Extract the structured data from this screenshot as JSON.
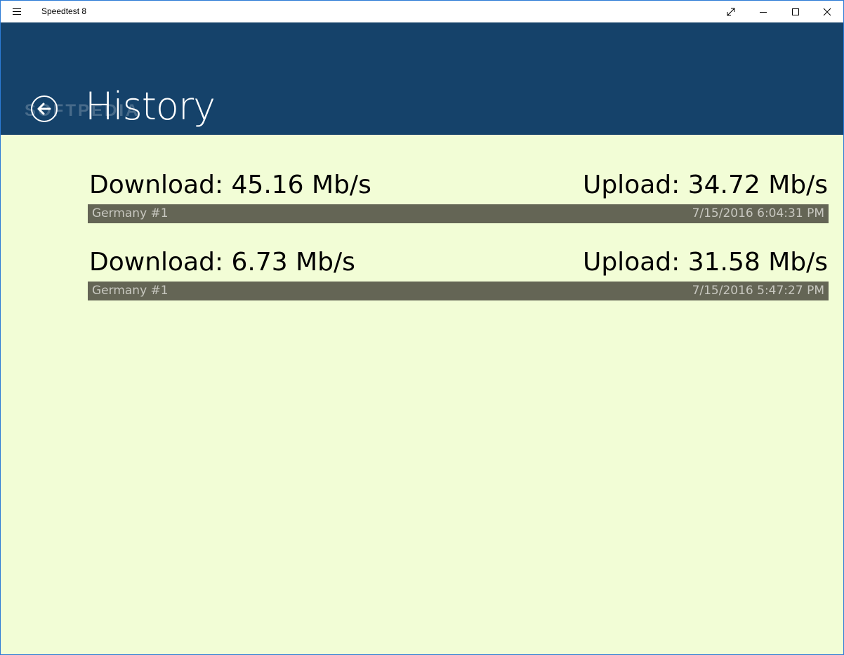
{
  "titlebar": {
    "app_title": "Speedtest 8",
    "menu_icon": "hamburger-icon",
    "fullscreen_icon": "expand-icon",
    "minimize_icon": "minimize-icon",
    "maximize_icon": "maximize-icon",
    "close_icon": "close-icon"
  },
  "header": {
    "title": "History",
    "back_icon": "back-arrow-icon",
    "watermark": "SOFTPEDIA",
    "background": "#15426a"
  },
  "colors": {
    "page_background": "#f2fdd6",
    "info_bar": "#646555",
    "info_text": "#c8c8c0"
  },
  "history": [
    {
      "download": "Download: 45.16 Mb/s",
      "upload": "Upload: 34.72 Mb/s",
      "server": "Germany #1",
      "timestamp": "7/15/2016 6:04:31 PM"
    },
    {
      "download": "Download: 6.73 Mb/s",
      "upload": "Upload: 31.58 Mb/s",
      "server": "Germany #1",
      "timestamp": "7/15/2016 5:47:27 PM"
    }
  ]
}
